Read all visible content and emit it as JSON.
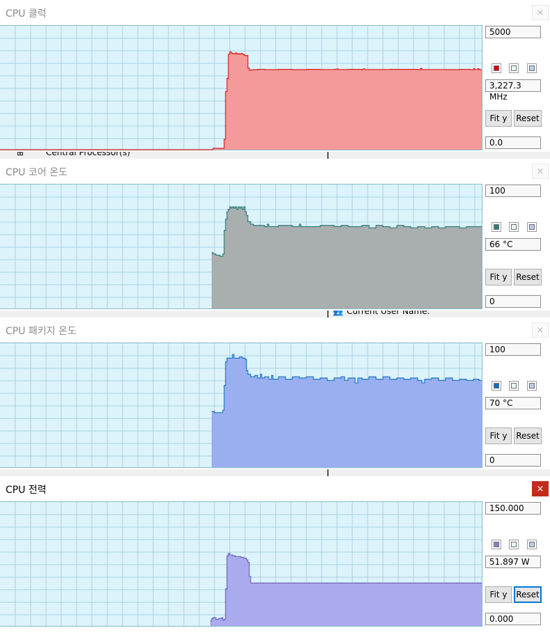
{
  "panels": [
    {
      "title": "CPU 클럭",
      "close_label": "×",
      "active": false,
      "max_label": "5000",
      "current_label": "3,227.3 MHz",
      "min_label": "0.0",
      "fit_label": "Fit y",
      "reset_label": "Reset",
      "reset_focused": false,
      "line_color": "#d42020",
      "fill_color": "#f59a9a",
      "swatch_color": "#e00000",
      "icons": [
        "line-color-swatch-icon",
        "fill-color-swatch-icon",
        "background-color-swatch-icon"
      ],
      "y_max": 5000,
      "series": [
        [
          0,
          0
        ],
        [
          304,
          0
        ],
        [
          306,
          56
        ],
        [
          320,
          56
        ],
        [
          322,
          420
        ],
        [
          324,
          2350
        ],
        [
          326,
          2880
        ],
        [
          328,
          3850
        ],
        [
          330,
          3950
        ],
        [
          332,
          3900
        ],
        [
          334,
          3880
        ],
        [
          336,
          3870
        ],
        [
          338,
          3900
        ],
        [
          340,
          3860
        ],
        [
          342,
          3880
        ],
        [
          344,
          3850
        ],
        [
          346,
          3880
        ],
        [
          348,
          3860
        ],
        [
          350,
          3820
        ],
        [
          352,
          3800
        ],
        [
          354,
          3800
        ],
        [
          356,
          3300
        ],
        [
          358,
          3200
        ],
        [
          360,
          3220
        ],
        [
          364,
          3230
        ],
        [
          370,
          3240
        ],
        [
          380,
          3230
        ],
        [
          400,
          3240
        ],
        [
          420,
          3230
        ],
        [
          440,
          3240
        ],
        [
          460,
          3235
        ],
        [
          480,
          3240
        ],
        [
          484,
          3260
        ],
        [
          486,
          3235
        ],
        [
          500,
          3240
        ],
        [
          520,
          3230
        ],
        [
          522,
          3260
        ],
        [
          524,
          3235
        ],
        [
          560,
          3240
        ],
        [
          600,
          3230
        ],
        [
          604,
          3280
        ],
        [
          606,
          3235
        ],
        [
          640,
          3230
        ],
        [
          660,
          3240
        ],
        [
          676,
          3225
        ],
        [
          680,
          3270
        ],
        [
          682,
          3235
        ],
        [
          686,
          3265
        ],
        [
          688,
          3227
        ]
      ]
    },
    {
      "title": "CPU 코어 온도",
      "close_label": "×",
      "active": false,
      "max_label": "100",
      "current_label": "66 °C",
      "min_label": "0",
      "fit_label": "Fit y",
      "reset_label": "Reset",
      "reset_focused": false,
      "line_color": "#2e7a7a",
      "fill_color": "#a9aeae",
      "swatch_color": "#2f7f82",
      "icons": [
        "line-color-swatch-icon",
        "fill-color-swatch-icon",
        "background-color-swatch-icon"
      ],
      "y_max": 100,
      "series": [
        [
          304,
          45
        ],
        [
          306,
          44
        ],
        [
          310,
          43
        ],
        [
          316,
          42
        ],
        [
          320,
          44
        ],
        [
          322,
          63
        ],
        [
          324,
          72
        ],
        [
          326,
          78
        ],
        [
          328,
          80
        ],
        [
          330,
          82
        ],
        [
          332,
          81
        ],
        [
          334,
          82
        ],
        [
          336,
          81
        ],
        [
          338,
          82
        ],
        [
          340,
          80
        ],
        [
          342,
          82
        ],
        [
          344,
          81
        ],
        [
          346,
          82
        ],
        [
          348,
          80
        ],
        [
          350,
          82
        ],
        [
          352,
          78
        ],
        [
          354,
          75
        ],
        [
          356,
          70
        ],
        [
          360,
          68
        ],
        [
          364,
          67
        ],
        [
          370,
          67
        ],
        [
          380,
          66
        ],
        [
          384,
          68
        ],
        [
          386,
          66
        ],
        [
          400,
          67
        ],
        [
          420,
          66
        ],
        [
          430,
          68
        ],
        [
          432,
          66
        ],
        [
          440,
          66
        ],
        [
          460,
          67
        ],
        [
          480,
          66
        ],
        [
          490,
          67
        ],
        [
          500,
          66
        ],
        [
          510,
          66
        ],
        [
          520,
          67
        ],
        [
          530,
          65
        ],
        [
          540,
          67
        ],
        [
          550,
          66
        ],
        [
          560,
          65
        ],
        [
          570,
          67
        ],
        [
          580,
          66
        ],
        [
          590,
          65
        ],
        [
          600,
          66
        ],
        [
          610,
          65
        ],
        [
          620,
          66
        ],
        [
          630,
          65
        ],
        [
          640,
          66
        ],
        [
          650,
          66
        ],
        [
          660,
          65
        ],
        [
          670,
          66
        ],
        [
          680,
          66
        ],
        [
          688,
          66
        ]
      ]
    },
    {
      "title": "CPU 패키지 온도",
      "close_label": "×",
      "active": false,
      "max_label": "100",
      "current_label": "70 °C",
      "min_label": "0",
      "fit_label": "Fit y",
      "reset_label": "Reset",
      "reset_focused": false,
      "line_color": "#1e78c2",
      "fill_color": "#9aaff0",
      "swatch_color": "#0a6fc2",
      "icons": [
        "line-color-swatch-icon",
        "fill-color-swatch-icon",
        "background-color-swatch-icon"
      ],
      "y_max": 100,
      "series": [
        [
          304,
          45
        ],
        [
          308,
          44
        ],
        [
          314,
          44
        ],
        [
          320,
          46
        ],
        [
          322,
          66
        ],
        [
          324,
          85
        ],
        [
          326,
          88
        ],
        [
          330,
          88
        ],
        [
          334,
          91
        ],
        [
          336,
          88
        ],
        [
          340,
          88
        ],
        [
          344,
          89
        ],
        [
          348,
          88
        ],
        [
          352,
          87
        ],
        [
          354,
          78
        ],
        [
          356,
          75
        ],
        [
          360,
          73
        ],
        [
          366,
          74
        ],
        [
          370,
          72
        ],
        [
          374,
          75
        ],
        [
          376,
          72
        ],
        [
          380,
          73
        ],
        [
          386,
          71
        ],
        [
          390,
          74
        ],
        [
          392,
          71
        ],
        [
          400,
          73
        ],
        [
          410,
          71
        ],
        [
          420,
          73
        ],
        [
          430,
          72
        ],
        [
          440,
          73
        ],
        [
          450,
          71
        ],
        [
          460,
          72
        ],
        [
          470,
          70
        ],
        [
          480,
          72
        ],
        [
          490,
          73
        ],
        [
          495,
          70
        ],
        [
          500,
          72
        ],
        [
          510,
          68
        ],
        [
          514,
          72
        ],
        [
          520,
          71
        ],
        [
          530,
          73
        ],
        [
          540,
          71
        ],
        [
          550,
          73
        ],
        [
          560,
          71
        ],
        [
          570,
          72
        ],
        [
          580,
          71
        ],
        [
          590,
          72
        ],
        [
          600,
          70
        ],
        [
          606,
          68
        ],
        [
          610,
          71
        ],
        [
          620,
          72
        ],
        [
          630,
          70
        ],
        [
          640,
          72
        ],
        [
          650,
          70
        ],
        [
          660,
          71
        ],
        [
          670,
          70
        ],
        [
          680,
          71
        ],
        [
          688,
          70
        ]
      ]
    },
    {
      "title": "CPU 전력",
      "close_label": "×",
      "active": true,
      "max_label": "150.000",
      "current_label": "51.897 W",
      "min_label": "0.000",
      "fit_label": "Fit y",
      "reset_label": "Reset",
      "reset_focused": true,
      "line_color": "#6a64b8",
      "fill_color": "#aaaaee",
      "swatch_color": "#8080c8",
      "icons": [
        "line-color-swatch-icon",
        "fill-color-swatch-icon",
        "background-color-swatch-icon"
      ],
      "y_max": 150,
      "series": [
        [
          302,
          6
        ],
        [
          304,
          9
        ],
        [
          306,
          10
        ],
        [
          310,
          8
        ],
        [
          314,
          9
        ],
        [
          318,
          10
        ],
        [
          320,
          7
        ],
        [
          322,
          8
        ],
        [
          324,
          45
        ],
        [
          326,
          85
        ],
        [
          328,
          88
        ],
        [
          330,
          86
        ],
        [
          334,
          85
        ],
        [
          338,
          84
        ],
        [
          342,
          84
        ],
        [
          346,
          83
        ],
        [
          350,
          82
        ],
        [
          354,
          80
        ],
        [
          356,
          77
        ],
        [
          358,
          60
        ],
        [
          360,
          52
        ],
        [
          362,
          51.9
        ],
        [
          380,
          51.9
        ],
        [
          400,
          51.9
        ],
        [
          450,
          51.9
        ],
        [
          500,
          51.9
        ],
        [
          550,
          51.9
        ],
        [
          600,
          51.9
        ],
        [
          650,
          51.9
        ],
        [
          688,
          51.9
        ]
      ]
    }
  ],
  "background_text": [
    {
      "text": "Central Processor(s)",
      "left": 66
    },
    {
      "text": "Current User Name:",
      "left": 498
    }
  ]
}
